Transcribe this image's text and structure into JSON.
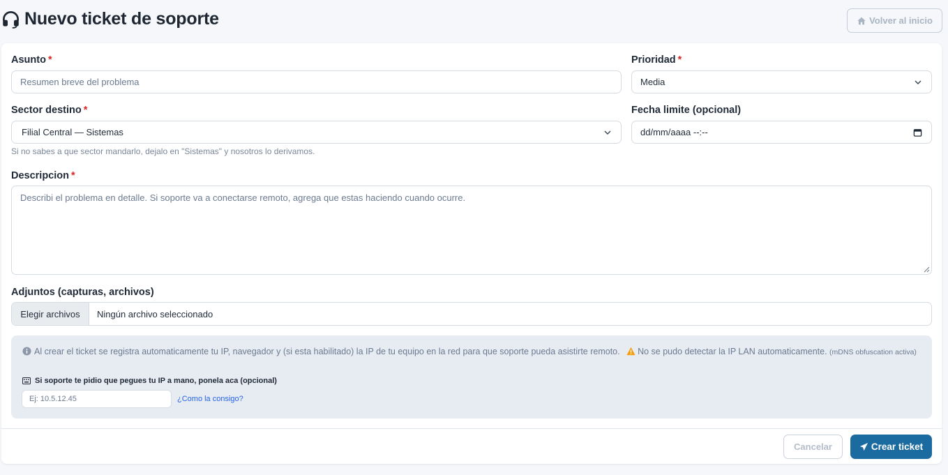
{
  "header": {
    "title": "Nuevo ticket de soporte",
    "back_label": "Volver al inicio"
  },
  "form": {
    "subject": {
      "label": "Asunto",
      "required": "*",
      "placeholder": "Resumen breve del problema"
    },
    "priority": {
      "label": "Prioridad",
      "required": "*",
      "value": "Media"
    },
    "sector": {
      "label": "Sector destino",
      "required": "*",
      "value": "Filial Central — Sistemas",
      "hint": "Si no sabes a que sector mandarlo, dejalo en \"Sistemas\" y nosotros lo derivamos."
    },
    "due_date": {
      "label": "Fecha limite (opcional)",
      "placeholder": "dd/mm/aaaa --:--"
    },
    "description": {
      "label": "Descripcion",
      "required": "*",
      "placeholder": "Describi el problema en detalle. Si soporte va a conectarse remoto, agrega que estas haciendo cuando ocurre."
    },
    "attachments": {
      "label": "Adjuntos (capturas, archivos)",
      "button": "Elegir archivos",
      "status": "Ningún archivo seleccionado"
    }
  },
  "info": {
    "text": "Al crear el ticket se registra automaticamente tu IP, navegador y (si esta habilitado) la IP de tu equipo en la red para que soporte pueda asistirte remoto.",
    "warning": "No se pudo detectar la IP LAN automaticamente.",
    "warning_detail": "(mDNS obfuscation activa)",
    "manual_label": "Si soporte te pidio que pegues tu IP a mano, ponela aca (opcional)",
    "ip_placeholder": "Ej: 10.5.12.45",
    "help_link": "¿Como la consigo?"
  },
  "footer": {
    "cancel": "Cancelar",
    "create": "Crear ticket"
  },
  "colors": {
    "primary": "#1b6aa0",
    "required": "#dc2626",
    "warning": "#f59e0b",
    "link": "#2563eb"
  }
}
